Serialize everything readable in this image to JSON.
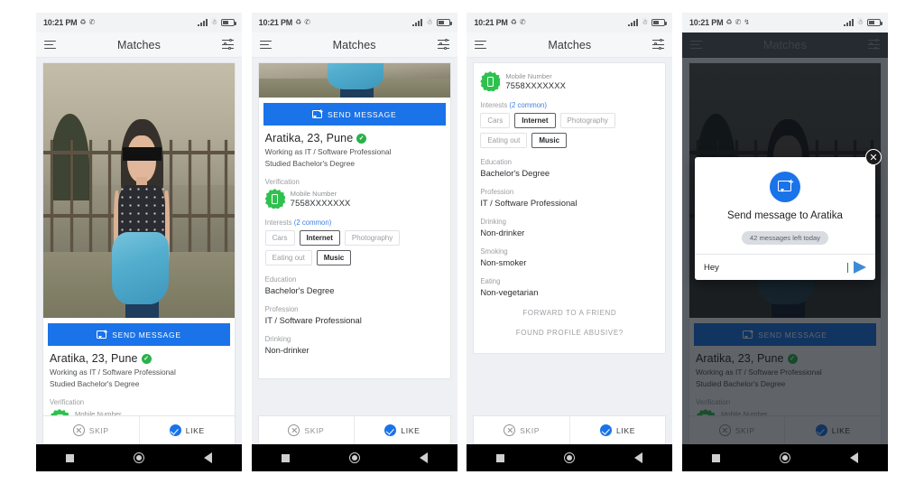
{
  "status_bar": {
    "time": "10:21 PM",
    "left_icons": [
      "sync-icon",
      "whatsapp-icon"
    ],
    "left_icons_p4": [
      "sync-icon",
      "whatsapp-icon",
      "bluetooth-icon"
    ],
    "right_icons": [
      "signal-icon",
      "wifi-icon",
      "battery-icon"
    ]
  },
  "app_bar": {
    "menu_icon": "hamburger-menu-icon",
    "title": "Matches",
    "filter_icon": "filter-sliders-icon"
  },
  "profile": {
    "name_line": "Aratika, 23, Pune",
    "verified_badge": "✓",
    "working": "Working as IT / Software Professional",
    "studied": "Studied Bachelor's Degree"
  },
  "send_message_button": {
    "label": "SEND MESSAGE",
    "icon": "message-plus-icon"
  },
  "verification": {
    "label": "Verification",
    "badge_icon": "verified-mobile-icon",
    "type": "Mobile Number",
    "number": "7558XXXXXXX"
  },
  "interests": {
    "label": "Interests",
    "common_note": "(2 common)",
    "chips": [
      {
        "label": "Cars",
        "common": false
      },
      {
        "label": "Internet",
        "common": true
      },
      {
        "label": "Photography",
        "common": false
      },
      {
        "label": "Eating out",
        "common": false
      },
      {
        "label": "Music",
        "common": true
      }
    ]
  },
  "details": [
    {
      "label": "Education",
      "value": "Bachelor's Degree"
    },
    {
      "label": "Profession",
      "value": "IT / Software Professional"
    },
    {
      "label": "Drinking",
      "value": "Non-drinker"
    },
    {
      "label": "Smoking",
      "value": "Non-smoker"
    },
    {
      "label": "Eating",
      "value": "Non-vegetarian"
    }
  ],
  "links": {
    "forward": "FORWARD TO A FRIEND",
    "abusive": "FOUND PROFILE ABUSIVE?"
  },
  "actions": {
    "skip_label": "SKIP",
    "skip_icon": "circle-x-icon",
    "like_label": "LIKE",
    "like_icon": "circle-check-icon"
  },
  "nav_bar": {
    "recents_icon": "square-recents-icon",
    "home_icon": "circle-home-icon",
    "back_icon": "triangle-back-icon"
  },
  "message_modal": {
    "close_icon": "close-icon",
    "header_icon": "message-plus-icon",
    "title": "Send message to Aratika",
    "quota_pill": "42 messages left today",
    "input_value": "Hey",
    "input_placeholder": "Hey",
    "send_icon": "send-paper-plane-icon"
  },
  "colors": {
    "accent_blue": "#1a73e8",
    "verified_green": "#2fc14f",
    "link_blue": "#3f7fe0",
    "muted_gray": "#9b9ea2",
    "nav_black": "#000000"
  }
}
